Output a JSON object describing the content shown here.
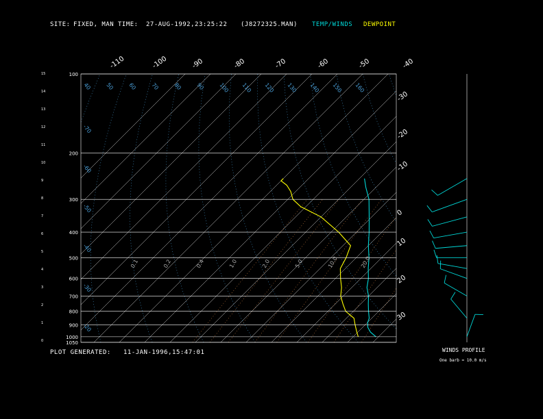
{
  "header": {
    "site_label": "SITE:",
    "site_value": "FIXED, MAN",
    "time_label": "TIME:",
    "time_value": "27-AUG-1992,23:25:22",
    "file": "(J8272325.MAN)",
    "legend_temp": "TEMP/WINDS",
    "legend_dew": "DEWPOINT"
  },
  "footer": {
    "generated_label": "PLOT GENERATED:",
    "generated_value": "11-JAN-1996,15:47:01"
  },
  "winds_panel": {
    "title": "WINDS PROFILE",
    "note": "One barb = 10.0 m/s"
  },
  "colors": {
    "background": "#000000",
    "temp": "#00d8d8",
    "dewpoint": "#ffff00",
    "isotherm": "#d8d8d8",
    "dry_adiabat": "#4a9fd8",
    "mixing_ratio": "#d08040",
    "grid": "#ffffff"
  },
  "chart_data": {
    "type": "line",
    "subtype": "skew-t log-p sounding",
    "pressure_levels": [
      100,
      200,
      300,
      400,
      500,
      600,
      700,
      800,
      900,
      1000,
      1050
    ],
    "height_km_ticks": [
      0,
      1,
      2,
      3,
      4,
      5,
      6,
      7,
      8,
      9,
      10,
      11,
      12,
      13,
      14,
      15
    ],
    "isotherm_labels_top": [
      -110,
      -100,
      -90,
      -80,
      -70,
      -60,
      -50,
      -40
    ],
    "isotherm_labels_right": [
      -30,
      -20,
      -10,
      0,
      10,
      20,
      30
    ],
    "dry_adiabat_labels_top": [
      40,
      50,
      60,
      70,
      80,
      90,
      100,
      110,
      120,
      130,
      140,
      150,
      160
    ],
    "dry_adiabat_labels_left": [
      -70,
      -60,
      -50,
      -40,
      -30,
      -20
    ],
    "mixing_ratio_labels_mid": [
      0.1,
      0.2,
      0.4,
      1.0,
      2.0,
      5.0,
      10.0,
      20.0
    ],
    "series": [
      {
        "name": "TEMP/WINDS",
        "points": [
          {
            "p": 1000,
            "t": 29
          },
          {
            "p": 960,
            "t": 25
          },
          {
            "p": 920,
            "t": 22
          },
          {
            "p": 880,
            "t": 20
          },
          {
            "p": 850,
            "t": 19
          },
          {
            "p": 800,
            "t": 16
          },
          {
            "p": 750,
            "t": 13
          },
          {
            "p": 700,
            "t": 10
          },
          {
            "p": 650,
            "t": 6
          },
          {
            "p": 600,
            "t": 3
          },
          {
            "p": 550,
            "t": -1
          },
          {
            "p": 500,
            "t": -5
          },
          {
            "p": 450,
            "t": -10
          },
          {
            "p": 400,
            "t": -15
          },
          {
            "p": 350,
            "t": -21
          },
          {
            "p": 300,
            "t": -28
          },
          {
            "p": 270,
            "t": -34
          },
          {
            "p": 250,
            "t": -38
          }
        ]
      },
      {
        "name": "DEWPOINT",
        "points": [
          {
            "p": 1000,
            "t": 22
          },
          {
            "p": 950,
            "t": 19
          },
          {
            "p": 900,
            "t": 16
          },
          {
            "p": 850,
            "t": 13
          },
          {
            "p": 800,
            "t": 7
          },
          {
            "p": 750,
            "t": 3
          },
          {
            "p": 700,
            "t": -1
          },
          {
            "p": 650,
            "t": -4
          },
          {
            "p": 600,
            "t": -8
          },
          {
            "p": 550,
            "t": -12
          },
          {
            "p": 500,
            "t": -14
          },
          {
            "p": 450,
            "t": -17
          },
          {
            "p": 400,
            "t": -27
          },
          {
            "p": 350,
            "t": -40
          },
          {
            "p": 320,
            "t": -52
          },
          {
            "p": 300,
            "t": -58
          },
          {
            "p": 280,
            "t": -62
          },
          {
            "p": 265,
            "t": -66
          },
          {
            "p": 255,
            "t": -70
          },
          {
            "p": 250,
            "t": -70
          }
        ]
      }
    ],
    "winds": [
      {
        "p": 250,
        "dir": 240,
        "kt": 12
      },
      {
        "p": 300,
        "dir": 250,
        "kt": 15
      },
      {
        "p": 350,
        "dir": 255,
        "kt": 14
      },
      {
        "p": 400,
        "dir": 260,
        "kt": 12
      },
      {
        "p": 450,
        "dir": 265,
        "kt": 10
      },
      {
        "p": 500,
        "dir": 270,
        "kt": 9
      },
      {
        "p": 550,
        "dir": 280,
        "kt": 8
      },
      {
        "p": 600,
        "dir": 290,
        "kt": 7
      },
      {
        "p": 700,
        "dir": 300,
        "kt": 5
      },
      {
        "p": 850,
        "dir": 320,
        "kt": 4
      },
      {
        "p": 1000,
        "dir": 20,
        "kt": 3
      }
    ]
  }
}
